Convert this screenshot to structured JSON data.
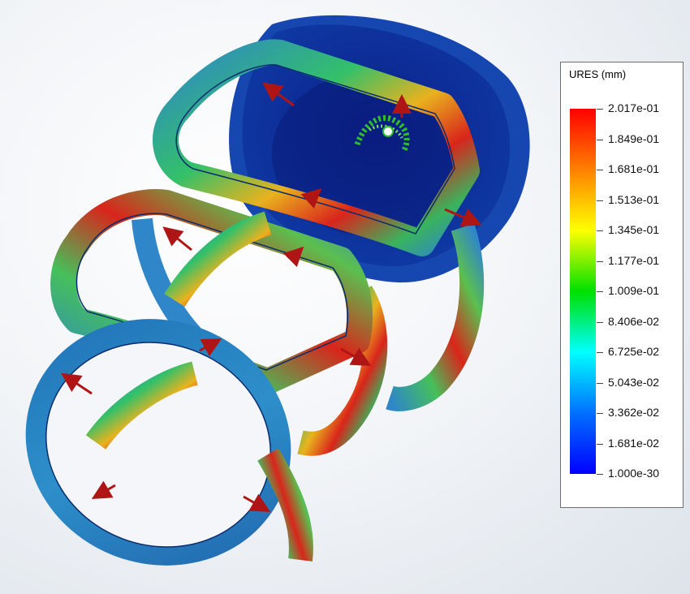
{
  "legend": {
    "title": "URES (mm)",
    "ticks": [
      "2.017e-01",
      "1.849e-01",
      "1.681e-01",
      "1.513e-01",
      "1.345e-01",
      "1.177e-01",
      "1.009e-01",
      "8.406e-02",
      "6.725e-02",
      "5.043e-02",
      "3.362e-02",
      "1.681e-02",
      "1.000e-30"
    ],
    "gradient_colors": [
      "#ff0000",
      "#ff8000",
      "#ffff00",
      "#00e000",
      "#00ffff",
      "#0070ff",
      "#0000ff"
    ]
  },
  "model": {
    "description_icons": [
      "fixture-icon",
      "load-arrow-icon"
    ],
    "colors": {
      "low": "#0c2a9a",
      "mid_low": "#2f7fbf",
      "mid": "#33c06a",
      "mid_high": "#e6a81e",
      "high": "#d9251b"
    }
  }
}
